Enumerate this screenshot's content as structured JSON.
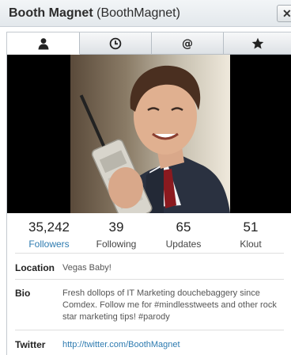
{
  "window": {
    "name": "Booth Magnet",
    "handle": "(BoothMagnet)",
    "close_label": "✕"
  },
  "tabs": [
    {
      "icon": "user-icon",
      "active": true
    },
    {
      "icon": "clock-icon",
      "active": false
    },
    {
      "icon": "at-icon",
      "active": false
    },
    {
      "icon": "star-icon",
      "active": false
    }
  ],
  "stats": [
    {
      "value": "35,242",
      "label": "Followers"
    },
    {
      "value": "39",
      "label": "Following"
    },
    {
      "value": "65",
      "label": "Updates"
    },
    {
      "value": "51",
      "label": "Klout"
    }
  ],
  "profile": {
    "location_label": "Location",
    "location_value": "Vegas Baby!",
    "bio_label": "Bio",
    "bio_value": "Fresh dollops of IT Marketing douchebaggery since Comdex. Follow me for #mindlesstweets and other rock star marketing tips! #parody",
    "twitter_label": "Twitter",
    "twitter_value": "http://twitter.com/BoothMagnet"
  },
  "colors": {
    "link": "#2e7bb0",
    "photo_letterbox": "#000000"
  }
}
